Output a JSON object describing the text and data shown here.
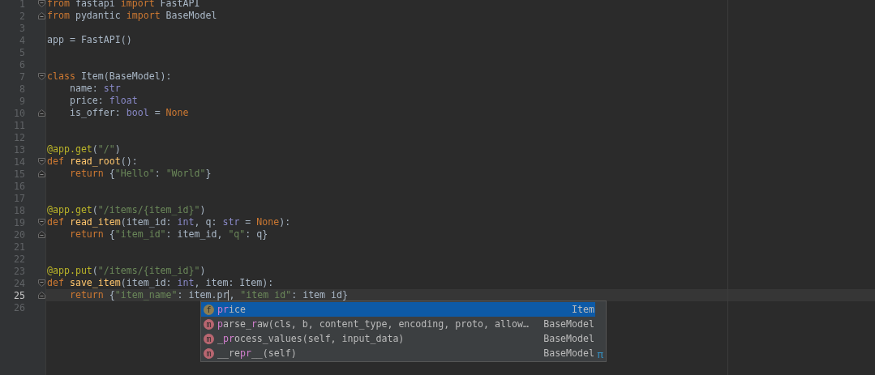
{
  "editor": {
    "lines": [
      {
        "number": "1",
        "fold_start": true,
        "fold_end": false,
        "current": false,
        "tokens": [
          {
            "kind": "keyword",
            "text": "from"
          },
          {
            "kind": "plain",
            "text": " fastapi "
          },
          {
            "kind": "keyword",
            "text": "import"
          },
          {
            "kind": "plain",
            "text": " FastAPI"
          }
        ]
      },
      {
        "number": "2",
        "fold_start": false,
        "fold_end": true,
        "current": false,
        "tokens": [
          {
            "kind": "keyword",
            "text": "from"
          },
          {
            "kind": "plain",
            "text": " pydantic "
          },
          {
            "kind": "keyword",
            "text": "import"
          },
          {
            "kind": "plain",
            "text": " BaseModel"
          }
        ]
      },
      {
        "number": "3",
        "fold_start": false,
        "fold_end": false,
        "current": false
      },
      {
        "number": "4",
        "fold_start": false,
        "fold_end": false,
        "current": false,
        "tokens": [
          {
            "kind": "plain",
            "text": "app = FastAPI()"
          }
        ]
      },
      {
        "number": "5",
        "fold_start": false,
        "fold_end": false,
        "current": false
      },
      {
        "number": "6",
        "fold_start": false,
        "fold_end": false,
        "current": false
      },
      {
        "number": "7",
        "fold_start": true,
        "fold_end": false,
        "current": false,
        "tokens": [
          {
            "kind": "keyword",
            "text": "class"
          },
          {
            "kind": "plain",
            "text": " Item(BaseModel):"
          }
        ]
      },
      {
        "number": "8",
        "fold_start": false,
        "fold_end": false,
        "current": false,
        "tokens": [
          {
            "kind": "plain",
            "text": "    name: "
          },
          {
            "kind": "builtin",
            "text": "str"
          }
        ]
      },
      {
        "number": "9",
        "fold_start": false,
        "fold_end": false,
        "current": false,
        "tokens": [
          {
            "kind": "plain",
            "text": "    price: "
          },
          {
            "kind": "builtin",
            "text": "float"
          }
        ]
      },
      {
        "number": "10",
        "fold_start": false,
        "fold_end": true,
        "current": false,
        "tokens": [
          {
            "kind": "plain",
            "text": "    is_offer: "
          },
          {
            "kind": "builtin",
            "text": "bool"
          },
          {
            "kind": "plain",
            "text": " = "
          },
          {
            "kind": "keyword",
            "text": "None"
          }
        ]
      },
      {
        "number": "11",
        "fold_start": false,
        "fold_end": false,
        "current": false
      },
      {
        "number": "12",
        "fold_start": false,
        "fold_end": false,
        "current": false
      },
      {
        "number": "13",
        "fold_start": false,
        "fold_end": false,
        "current": false,
        "tokens": [
          {
            "kind": "decorator",
            "text": "@app.get"
          },
          {
            "kind": "plain",
            "text": "("
          },
          {
            "kind": "string",
            "text": "\"/\""
          },
          {
            "kind": "plain",
            "text": ")"
          }
        ]
      },
      {
        "number": "14",
        "fold_start": true,
        "fold_end": false,
        "current": false,
        "tokens": [
          {
            "kind": "keyword",
            "text": "def"
          },
          {
            "kind": "function",
            "text": " read_root"
          },
          {
            "kind": "plain",
            "text": "():"
          }
        ]
      },
      {
        "number": "15",
        "fold_start": false,
        "fold_end": true,
        "current": false,
        "tokens": [
          {
            "kind": "keyword",
            "text": "    return"
          },
          {
            "kind": "plain",
            "text": " {"
          },
          {
            "kind": "string",
            "text": "\"Hello\""
          },
          {
            "kind": "plain",
            "text": ": "
          },
          {
            "kind": "string",
            "text": "\"World\""
          },
          {
            "kind": "plain",
            "text": "}"
          }
        ]
      },
      {
        "number": "16",
        "fold_start": false,
        "fold_end": false,
        "current": false
      },
      {
        "number": "17",
        "fold_start": false,
        "fold_end": false,
        "current": false
      },
      {
        "number": "18",
        "fold_start": false,
        "fold_end": false,
        "current": false,
        "tokens": [
          {
            "kind": "decorator",
            "text": "@app.get"
          },
          {
            "kind": "plain",
            "text": "("
          },
          {
            "kind": "string",
            "text": "\"/items/{item_id}\""
          },
          {
            "kind": "plain",
            "text": ")"
          }
        ]
      },
      {
        "number": "19",
        "fold_start": true,
        "fold_end": false,
        "current": false,
        "tokens": [
          {
            "kind": "keyword",
            "text": "def"
          },
          {
            "kind": "function",
            "text": " read_item"
          },
          {
            "kind": "plain",
            "text": "(item_id: "
          },
          {
            "kind": "builtin",
            "text": "int"
          },
          {
            "kind": "plain",
            "text": ", q: "
          },
          {
            "kind": "builtin",
            "text": "str"
          },
          {
            "kind": "plain",
            "text": " = "
          },
          {
            "kind": "keyword",
            "text": "None"
          },
          {
            "kind": "plain",
            "text": "):"
          }
        ]
      },
      {
        "number": "20",
        "fold_start": false,
        "fold_end": true,
        "current": false,
        "tokens": [
          {
            "kind": "keyword",
            "text": "    return"
          },
          {
            "kind": "plain",
            "text": " {"
          },
          {
            "kind": "string",
            "text": "\"item_id\""
          },
          {
            "kind": "plain",
            "text": ": item_id, "
          },
          {
            "kind": "string",
            "text": "\"q\""
          },
          {
            "kind": "plain",
            "text": ": q}"
          }
        ]
      },
      {
        "number": "21",
        "fold_start": false,
        "fold_end": false,
        "current": false
      },
      {
        "number": "22",
        "fold_start": false,
        "fold_end": false,
        "current": false
      },
      {
        "number": "23",
        "fold_start": false,
        "fold_end": false,
        "current": false,
        "tokens": [
          {
            "kind": "decorator",
            "text": "@app.put"
          },
          {
            "kind": "plain",
            "text": "("
          },
          {
            "kind": "string",
            "text": "\"/items/{item_id}\""
          },
          {
            "kind": "plain",
            "text": ")"
          }
        ]
      },
      {
        "number": "24",
        "fold_start": true,
        "fold_end": false,
        "current": false,
        "tokens": [
          {
            "kind": "keyword",
            "text": "def"
          },
          {
            "kind": "function",
            "text": " save_item"
          },
          {
            "kind": "plain",
            "text": "(item_id: "
          },
          {
            "kind": "builtin",
            "text": "int"
          },
          {
            "kind": "plain",
            "text": ", item: Item):"
          }
        ]
      },
      {
        "number": "25",
        "fold_start": false,
        "fold_end": true,
        "current": true,
        "tokens": [
          {
            "kind": "keyword",
            "text": "    return",
            "caret_after": false
          },
          {
            "kind": "plain",
            "text": " {",
            "caret_after": false
          },
          {
            "kind": "string",
            "text": "\"item_name\"",
            "caret_after": false
          },
          {
            "kind": "plain",
            "text": ": item.pr",
            "caret_after": true
          },
          {
            "kind": "plain",
            "text": ", ",
            "caret_after": false
          },
          {
            "kind": "string",
            "text": "\"item id\"",
            "caret_after": false
          },
          {
            "kind": "plain",
            "text": ": item id}",
            "caret_after": false
          }
        ]
      },
      {
        "number": "26",
        "fold_start": false,
        "fold_end": false,
        "current": false
      }
    ]
  },
  "completion": {
    "items": [
      {
        "kind": "field",
        "icon": "f",
        "selected": true,
        "segments": [
          {
            "text": "pr",
            "match": true
          },
          {
            "text": "ice",
            "match": false
          }
        ],
        "type": "Item"
      },
      {
        "kind": "method",
        "icon": "m",
        "selected": false,
        "segments": [
          {
            "text": "p",
            "match": true
          },
          {
            "text": "arse_",
            "match": false
          },
          {
            "text": "r",
            "match": true
          },
          {
            "text": "aw(cls, b, content_type, encoding, proto, allow…",
            "match": false
          }
        ],
        "type": "BaseModel"
      },
      {
        "kind": "method",
        "icon": "m",
        "selected": false,
        "segments": [
          {
            "text": "_",
            "match": false
          },
          {
            "text": "pr",
            "match": true
          },
          {
            "text": "ocess_values(self, input_data)",
            "match": false
          }
        ],
        "type": "BaseModel"
      },
      {
        "kind": "method",
        "icon": "m",
        "selected": false,
        "segments": [
          {
            "text": "__re",
            "match": false
          },
          {
            "text": "pr",
            "match": true
          },
          {
            "text": "__(self)",
            "match": false
          }
        ],
        "type": "BaseModel"
      }
    ],
    "footer_glyph": "π"
  }
}
